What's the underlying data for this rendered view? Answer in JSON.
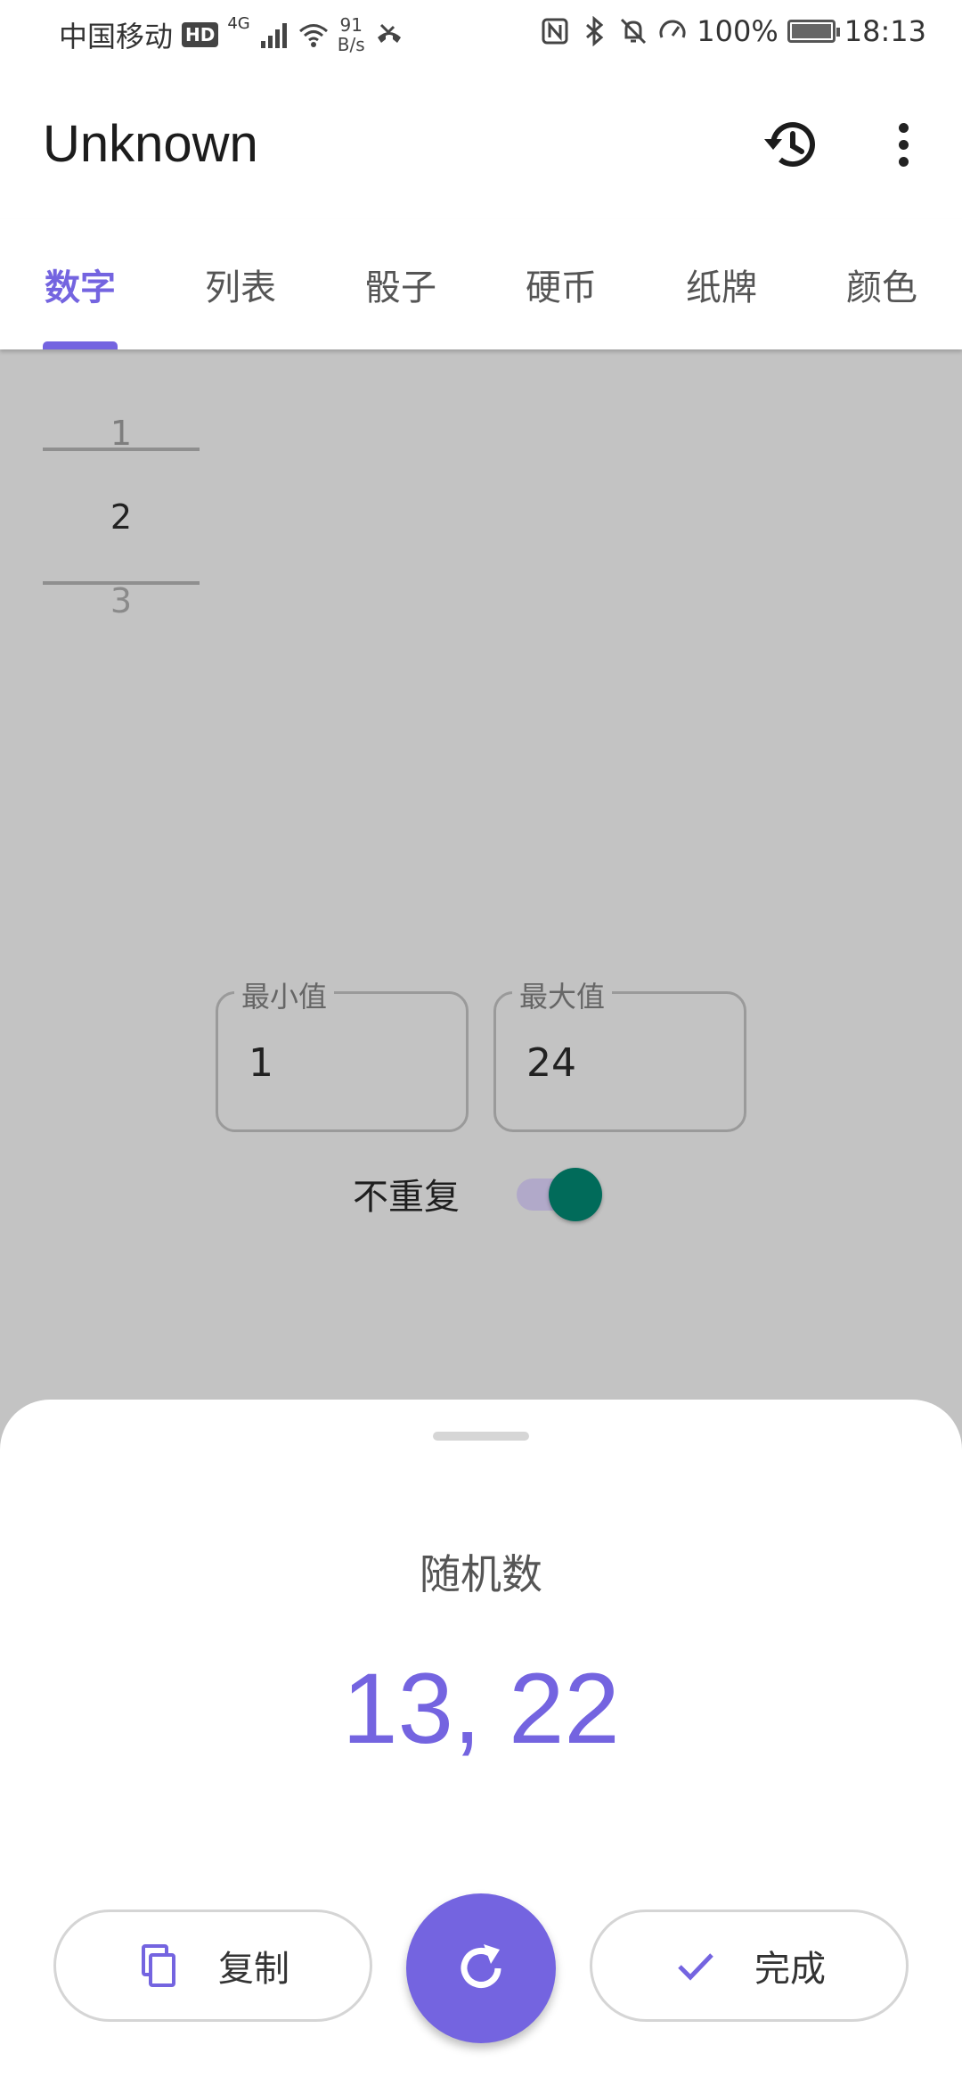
{
  "status_bar": {
    "carrier": "中国移动",
    "hd": "HD",
    "network": "4G",
    "speed_value": "91",
    "speed_unit": "B/s",
    "battery": "100%",
    "time": "18:13"
  },
  "app_bar": {
    "title": "Unknown",
    "history_icon": "history-icon",
    "more_icon": "more-vert-icon"
  },
  "tabs": [
    {
      "label": "数字",
      "active": true
    },
    {
      "label": "列表",
      "active": false
    },
    {
      "label": "骰子",
      "active": false
    },
    {
      "label": "硬币",
      "active": false
    },
    {
      "label": "纸牌",
      "active": false
    },
    {
      "label": "颜色",
      "active": false
    }
  ],
  "picker": {
    "prev": "1",
    "current": "2",
    "next": "3"
  },
  "range": {
    "min_label": "最小值",
    "min_value": "1",
    "max_label": "最大值",
    "max_value": "24"
  },
  "no_repeat": {
    "label": "不重复",
    "enabled": true
  },
  "sheet": {
    "title": "随机数",
    "result": "13, 22",
    "copy_label": "复制",
    "done_label": "完成",
    "refresh_icon": "refresh-icon"
  },
  "colors": {
    "accent": "#7464e0",
    "switch_thumb": "#016b5a",
    "scrim": "#c3c3c3"
  }
}
